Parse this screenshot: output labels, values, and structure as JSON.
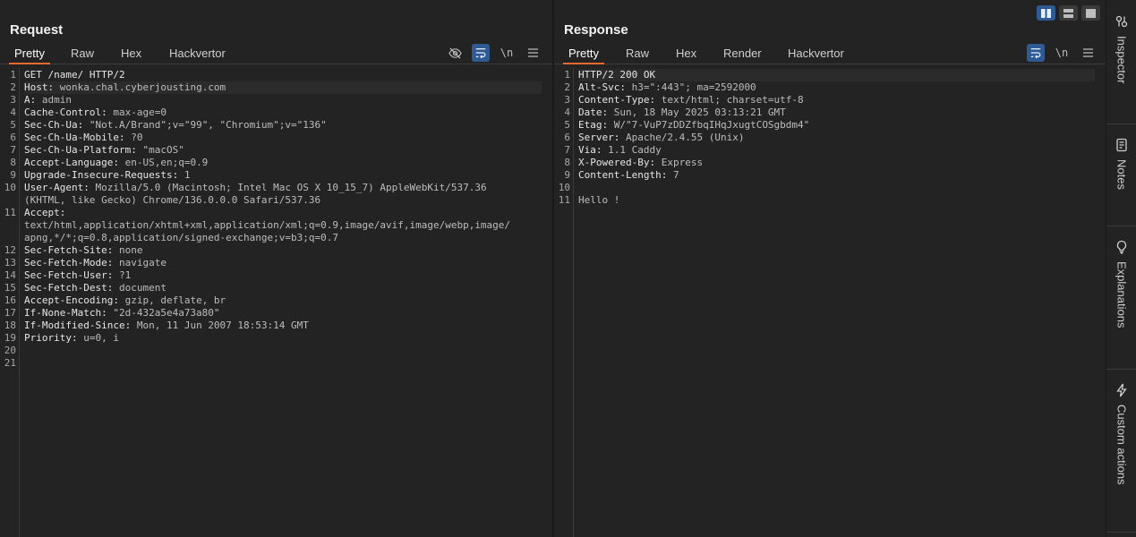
{
  "request": {
    "title": "Request",
    "tabs": [
      "Pretty",
      "Raw",
      "Hex",
      "Hackvertor"
    ],
    "tools": [
      "eye-off-icon",
      "wrap-icon",
      "newline-toggle",
      "menu-icon"
    ],
    "newline_label": "\\n",
    "lines": [
      {
        "n": "1",
        "k": "GET /name/ HTTP/2",
        "v": ""
      },
      {
        "n": "2",
        "k": "Host: ",
        "v": "wonka.chal.cyberjousting.com",
        "hl": true
      },
      {
        "n": "3",
        "k": "A: ",
        "v": "admin"
      },
      {
        "n": "4",
        "k": "Cache-Control: ",
        "v": "max-age=0"
      },
      {
        "n": "5",
        "k": "Sec-Ch-Ua: ",
        "v": "\"Not.A/Brand\";v=\"99\", \"Chromium\";v=\"136\""
      },
      {
        "n": "6",
        "k": "Sec-Ch-Ua-Mobile: ",
        "v": "?0"
      },
      {
        "n": "7",
        "k": "Sec-Ch-Ua-Platform: ",
        "v": "\"macOS\""
      },
      {
        "n": "8",
        "k": "Accept-Language: ",
        "v": "en-US,en;q=0.9"
      },
      {
        "n": "9",
        "k": "Upgrade-Insecure-Requests: ",
        "v": "1"
      },
      {
        "n": "10",
        "k": "User-Agent: ",
        "v": "Mozilla/5.0 (Macintosh; Intel Mac OS X 10_15_7) AppleWebKit/537.36"
      },
      {
        "n": "",
        "k": "",
        "v": "(KHTML, like Gecko) Chrome/136.0.0.0 Safari/537.36"
      },
      {
        "n": "11",
        "k": "Accept: ",
        "v": ""
      },
      {
        "n": "",
        "k": "",
        "v": "text/html,application/xhtml+xml,application/xml;q=0.9,image/avif,image/webp,image/"
      },
      {
        "n": "",
        "k": "",
        "v": "apng,*/*;q=0.8,application/signed-exchange;v=b3;q=0.7"
      },
      {
        "n": "12",
        "k": "Sec-Fetch-Site: ",
        "v": "none"
      },
      {
        "n": "13",
        "k": "Sec-Fetch-Mode: ",
        "v": "navigate"
      },
      {
        "n": "14",
        "k": "Sec-Fetch-User: ",
        "v": "?1"
      },
      {
        "n": "15",
        "k": "Sec-Fetch-Dest: ",
        "v": "document"
      },
      {
        "n": "16",
        "k": "Accept-Encoding: ",
        "v": "gzip, deflate, br"
      },
      {
        "n": "17",
        "k": "If-None-Match: ",
        "v": "\"2d-432a5e4a73a80\""
      },
      {
        "n": "18",
        "k": "If-Modified-Since: ",
        "v": "Mon, 11 Jun 2007 18:53:14 GMT"
      },
      {
        "n": "19",
        "k": "Priority: ",
        "v": "u=0, i"
      },
      {
        "n": "20",
        "k": "",
        "v": ""
      },
      {
        "n": "21",
        "k": "",
        "v": ""
      }
    ]
  },
  "response": {
    "title": "Response",
    "tabs": [
      "Pretty",
      "Raw",
      "Hex",
      "Render",
      "Hackvertor"
    ],
    "newline_label": "\\n",
    "lines": [
      {
        "n": "1",
        "k": "HTTP/2 200 OK",
        "v": "",
        "hl": true
      },
      {
        "n": "2",
        "k": "Alt-Svc: ",
        "v": "h3=\":443\"; ma=2592000"
      },
      {
        "n": "3",
        "k": "Content-Type: ",
        "v": "text/html; charset=utf-8"
      },
      {
        "n": "4",
        "k": "Date: ",
        "v": "Sun, 18 May 2025 03:13:21 GMT"
      },
      {
        "n": "5",
        "k": "Etag: ",
        "v": "W/\"7-VuP7zDDZfbqIHqJxugtCOSgbdm4\""
      },
      {
        "n": "6",
        "k": "Server: ",
        "v": "Apache/2.4.55 (Unix)"
      },
      {
        "n": "7",
        "k": "Via: ",
        "v": "1.1 Caddy"
      },
      {
        "n": "8",
        "k": "X-Powered-By: ",
        "v": "Express"
      },
      {
        "n": "9",
        "k": "Content-Length: ",
        "v": "7"
      },
      {
        "n": "10",
        "k": "",
        "v": ""
      },
      {
        "n": "11",
        "k": "",
        "v": "Hello !"
      }
    ]
  },
  "sidebar": {
    "items": [
      "Inspector",
      "Notes",
      "Explanations",
      "Custom actions"
    ]
  }
}
